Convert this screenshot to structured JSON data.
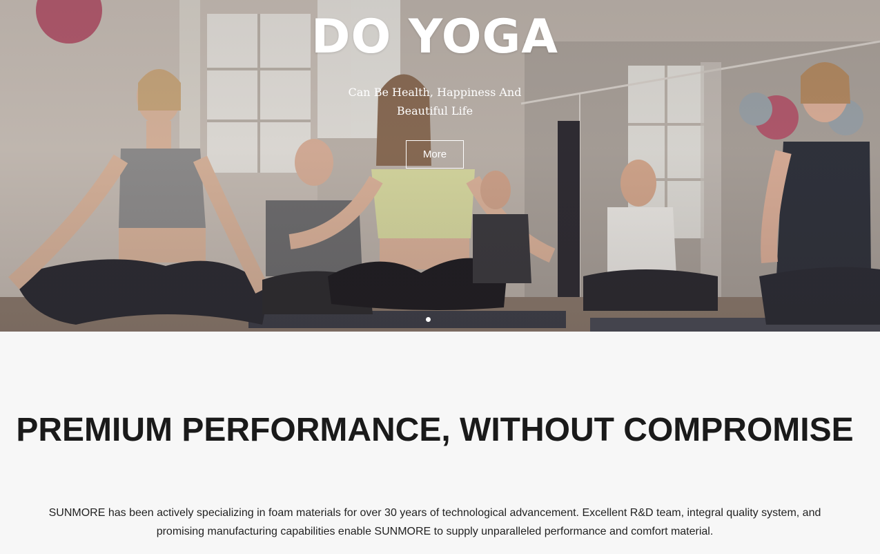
{
  "hero": {
    "title": "DO YOGA",
    "subtitle_line1": "Can Be Health, Happiness And",
    "subtitle_line2": "Beautiful Life",
    "button_label": "More",
    "slides": [
      {
        "active": true
      }
    ]
  },
  "section": {
    "title": "PREMIUM PERFORMANCE, WITHOUT COMPROMISE",
    "body": "SUNMORE has been actively specializing in foam materials for over 30 years of technological advancement. Excellent R&D team, integral quality system, and promising manufacturing capabilities enable SUNMORE to supply unparalleled performance and comfort material."
  },
  "colors": {
    "hero_overlay_text": "#ffffff",
    "section_background": "#f7f7f7",
    "heading_text": "#1a1a1a",
    "body_text": "#222222"
  }
}
